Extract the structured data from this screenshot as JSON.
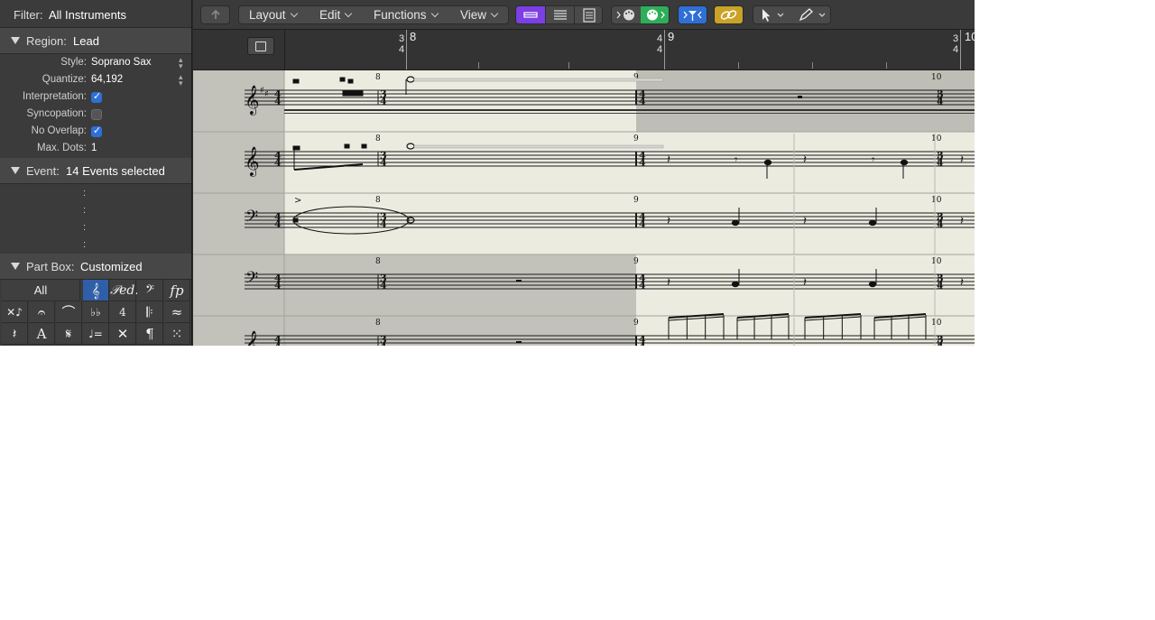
{
  "inspector": {
    "filter": {
      "label": "Filter:",
      "value": "All Instruments"
    },
    "region": {
      "label": "Region:",
      "value": "Lead",
      "rows": [
        {
          "key": "Style:",
          "value": "Soprano Sax"
        },
        {
          "key": "Quantize:",
          "value": "64,192"
        },
        {
          "key": "Interpretation:",
          "checked": true
        },
        {
          "key": "Syncopation:",
          "checked": false
        },
        {
          "key": "No Overlap:",
          "checked": true
        },
        {
          "key": "Max. Dots:",
          "value": "1"
        }
      ]
    },
    "event": {
      "label": "Event:",
      "value": "14 Events selected",
      "colons": [
        ":",
        ":",
        ":",
        ":"
      ]
    },
    "part_box": {
      "label": "Part Box:",
      "value": "Customized",
      "all_label": "All",
      "symbols": [
        "𝄞",
        "𝆮",
        "𝄢",
        "fp",
        "⨯",
        "𝄐",
        "⌒",
        "♭♭",
        "4",
        "𝄆",
        "ꭤ",
        "𝄽",
        "A",
        "𝄋",
        "♩=",
        "✕",
        "¶",
        "⁙"
      ]
    }
  },
  "toolbar": {
    "back_icon": "back-arrow-icon",
    "menus": [
      {
        "label": "Layout"
      },
      {
        "label": "Edit"
      },
      {
        "label": "Functions"
      },
      {
        "label": "View"
      }
    ],
    "view_modes": [
      "linear-view-icon",
      "page-view-icon",
      "print-view-icon"
    ],
    "midi_in_icon": "midi-in-icon",
    "midi_out_icon": "midi-out-icon",
    "catch_icon": "catch-playhead-icon",
    "link_icon": "link-icon",
    "pointer_tool_icon": "pointer-tool-icon",
    "pencil_tool_icon": "pencil-tool-icon",
    "accent_purple": "#7b3fe4",
    "accent_green": "#2fae5a",
    "accent_blue": "#2f6fd6",
    "accent_yellow": "#c9a227"
  },
  "ruler": {
    "bars": [
      {
        "number": "8",
        "ts_top": "3",
        "ts_bottom": "4"
      },
      {
        "number": "9",
        "ts_top": "4",
        "ts_bottom": "4"
      },
      {
        "number": "10",
        "ts_top": "3",
        "ts_bottom": "4"
      }
    ]
  },
  "score": {
    "measure_numbers": [
      "8",
      "9",
      "10"
    ],
    "timesig": {
      "a_top": "4",
      "a_bottom": "4",
      "b_top": "3",
      "b_bottom": "4"
    },
    "staves": [
      {
        "clef": "treble",
        "key": "D major"
      },
      {
        "clef": "treble",
        "key": "C major"
      },
      {
        "clef": "bass",
        "key": "C major"
      },
      {
        "clef": "bass",
        "key": "C major"
      },
      {
        "clef": "treble",
        "key": "C major"
      }
    ],
    "colors": {
      "bg": "#c0bfb8",
      "selected": "#ecebe0",
      "line": "#1a1a1a",
      "dark_staff_bg": "#bdbcb4"
    }
  }
}
